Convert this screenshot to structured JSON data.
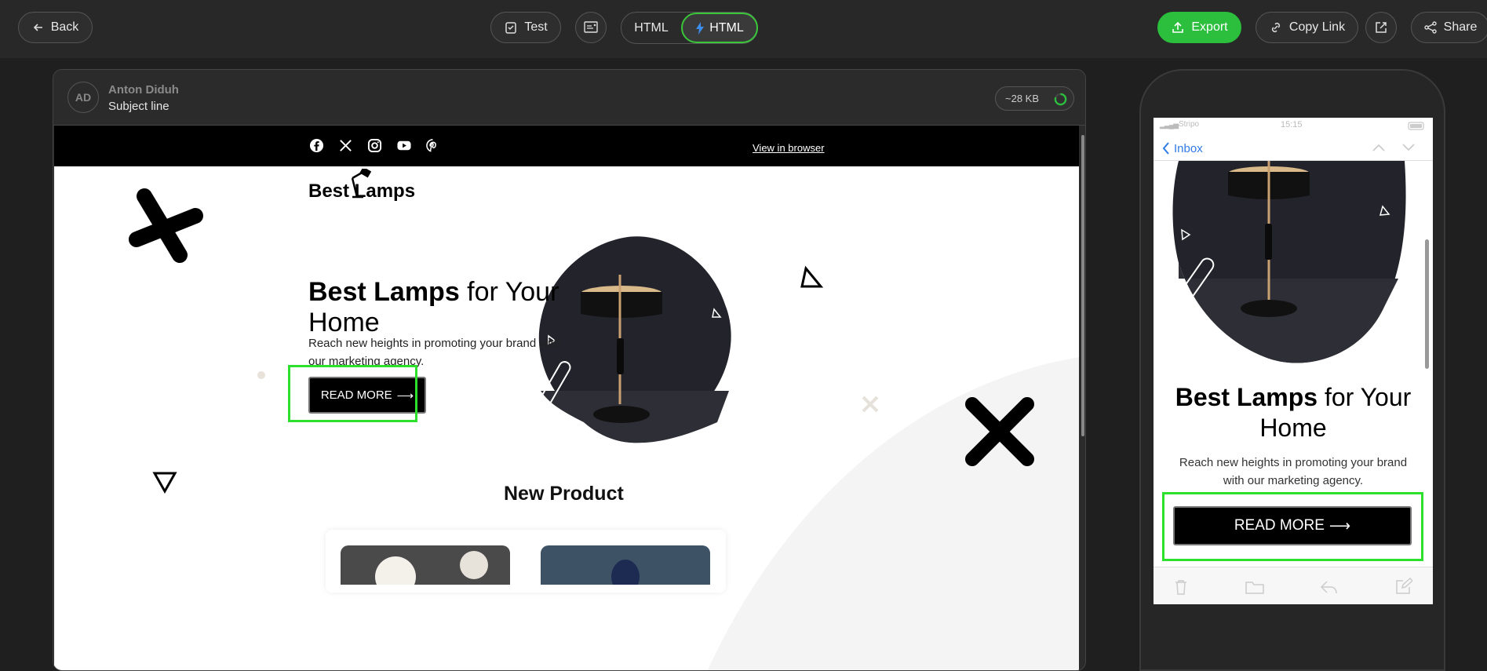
{
  "toolbar": {
    "back_label": "Back",
    "test_label": "Test",
    "html_label": "HTML",
    "amp_html_label": "HTML",
    "export_label": "Export",
    "copy_link_label": "Copy Link",
    "share_label": "Share"
  },
  "preview": {
    "avatar_initials": "AD",
    "sender_name": "Anton Diduh",
    "subject": "Subject line",
    "size": "~28 KB"
  },
  "email": {
    "view_in_browser": "View in browser",
    "logo_text": "Best Lamps",
    "hero_title_bold": "Best Lamps",
    "hero_title_rest": " for Your Home",
    "hero_subtitle": "Reach new heights in promoting your brand with our marketing agency.",
    "read_more_label": "READ MORE",
    "arrow": "⟶",
    "section_title": "New Product"
  },
  "mobile": {
    "carrier": "Stripo",
    "time": "15:15",
    "inbox_label": "Inbox",
    "hero_title_bold": "Best Lamps",
    "hero_title_rest": " for Your Home",
    "hero_subtitle": "Reach new heights in promoting your brand with our marketing agency.",
    "read_more_label": "READ MORE",
    "arrow": "⟶"
  },
  "colors": {
    "accent_green": "#2bbf3d",
    "highlight_green": "#2ee02e",
    "inbox_blue": "#2f7be5"
  }
}
